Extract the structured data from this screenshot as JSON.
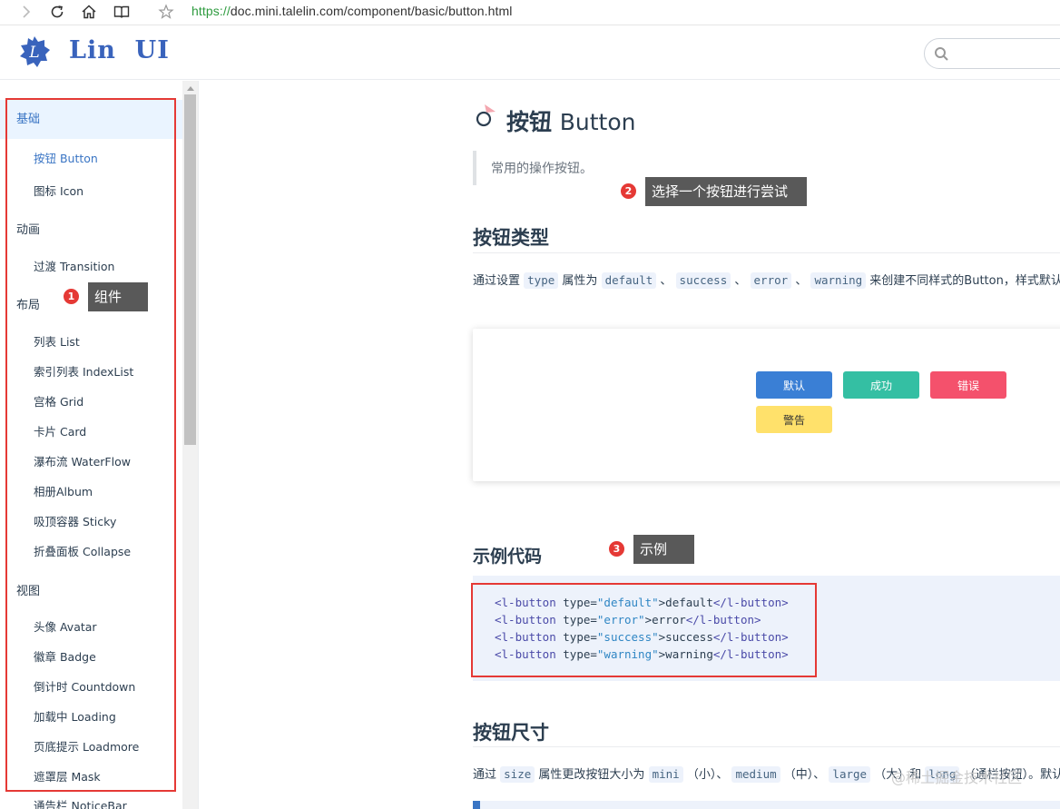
{
  "browser": {
    "url_scheme": "https://",
    "url_rest": "doc.mini.talelin.com/component/basic/button.html"
  },
  "header": {
    "logo_text": "Lin  UI",
    "search_placeholder": ""
  },
  "sidebar": {
    "groups": [
      {
        "label": "基础",
        "items": [
          "按钮 Button",
          "图标 Icon"
        ]
      },
      {
        "label": "动画",
        "items": [
          "过渡 Transition"
        ]
      },
      {
        "label": "布局",
        "items": [
          "列表 List",
          "索引列表 IndexList",
          "宫格 Grid",
          "卡片 Card",
          "瀑布流 WaterFlow",
          "相册Album",
          "吸顶容器 Sticky",
          "折叠面板 Collapse"
        ]
      },
      {
        "label": "视图",
        "items": [
          "头像 Avatar",
          "徽章 Badge",
          "倒计时 Countdown",
          "加载中 Loading",
          "页底提示 Loadmore",
          "遮罩层 Mask",
          "通告栏 NoticeBar"
        ]
      }
    ]
  },
  "annotations": [
    {
      "num": "1",
      "text": "组件"
    },
    {
      "num": "2",
      "text": "选择一个按钮进行尝试"
    },
    {
      "num": "3",
      "text": "示例"
    }
  ],
  "content": {
    "title_cn": "按钮",
    "title_en": "Button",
    "description": "常用的操作按钮。",
    "section_types": "按钮类型",
    "types_para": {
      "p1": "通过设置",
      "c1": "type",
      "p2": "属性为",
      "c2": "default",
      "sep1": "、",
      "c3": "success",
      "sep2": "、",
      "c4": "error",
      "sep3": "、",
      "c5": "warning",
      "p3": "来创建不同样式的Button，样式默认为"
    },
    "demo_buttons": [
      {
        "label": "默认",
        "color": "#3a7fd5"
      },
      {
        "label": "成功",
        "color": "#34bfa3"
      },
      {
        "label": "错误",
        "color": "#f4516c"
      },
      {
        "label": "警告",
        "color": "#ffe16b",
        "text_color": "#333333"
      }
    ],
    "section_example": "示例代码",
    "code_lines": [
      {
        "open": "<l-button ",
        "attr": "type=",
        "val": "\"default\"",
        "text": ">default",
        "close": "</l-button>"
      },
      {
        "open": "<l-button ",
        "attr": "type=",
        "val": "\"error\"",
        "text": ">error",
        "close": "</l-button>"
      },
      {
        "open": "<l-button ",
        "attr": "type=",
        "val": "\"success\"",
        "text": ">success",
        "close": "</l-button>"
      },
      {
        "open": "<l-button ",
        "attr": "type=",
        "val": "\"warning\"",
        "text": ">warning",
        "close": "</l-button>"
      }
    ],
    "section_size": "按钮尺寸",
    "size_para": {
      "p1": "通过",
      "c1": "size",
      "p2": "属性更改按钮大小为",
      "c2": "mini",
      "p3": "（小）、",
      "c3": "medium",
      "p4": "（中）、",
      "c4": "large",
      "p5": "（大）和",
      "c5": "long",
      "p6": "（通栏按钮）。默认为"
    },
    "watermark": "@稀土掘金技术社区"
  },
  "colors": {
    "accent": "#3a75c4",
    "annotation_red": "#e53935"
  }
}
